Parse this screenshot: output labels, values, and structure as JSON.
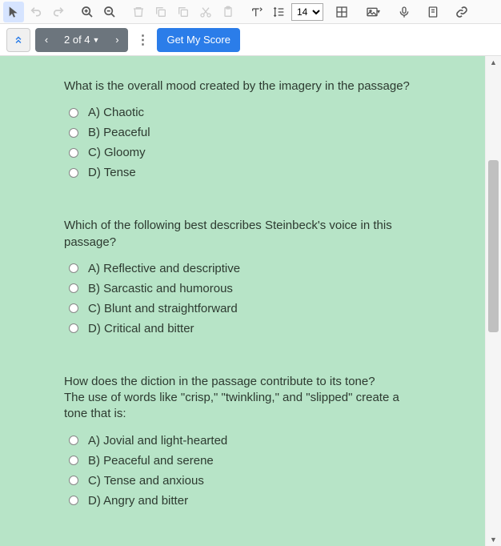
{
  "toolbar": {
    "font_size_value": "14"
  },
  "navbar": {
    "page_indicator": "2 of 4",
    "score_label": "Get My Score"
  },
  "questions": [
    {
      "text": "What is the overall mood created by the imagery in the passage?",
      "options": [
        "A) Chaotic",
        "B) Peaceful",
        "C) Gloomy",
        "D) Tense"
      ]
    },
    {
      "text": "Which of the following best describes Steinbeck's voice in this passage?",
      "options": [
        "A) Reflective and descriptive",
        "B) Sarcastic and humorous",
        "C) Blunt and straightforward",
        "D) Critical and bitter"
      ]
    },
    {
      "text": "How does the diction in the passage contribute to its tone?\nThe use of words like \"crisp,\" \"twinkling,\" and \"slipped\" create a tone that is:",
      "options": [
        "A) Jovial and light-hearted",
        "B) Peaceful and serene",
        "C) Tense and anxious",
        "D) Angry and bitter"
      ]
    }
  ]
}
